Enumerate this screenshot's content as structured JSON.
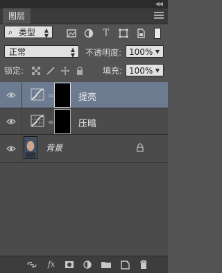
{
  "panel": {
    "tab_label": "图层"
  },
  "filter": {
    "kind_label": "类型",
    "icons": [
      "pixel-filter-icon",
      "adjustment-filter-icon",
      "type-filter-icon",
      "shape-filter-icon",
      "smart-object-filter-icon"
    ]
  },
  "blend": {
    "mode": "正常",
    "opacity_label": "不透明度:",
    "opacity_value": "100%"
  },
  "lock": {
    "label": "锁定:",
    "fill_label": "填充:",
    "fill_value": "100%"
  },
  "layers": [
    {
      "name": "提亮",
      "type": "curves-adjustment",
      "visible": true,
      "selected": true
    },
    {
      "name": "压暗",
      "type": "curves-adjustment",
      "visible": true,
      "selected": false
    },
    {
      "name": "背景",
      "type": "background",
      "visible": true,
      "selected": false,
      "locked": true
    }
  ],
  "bottom_toolbar": [
    "link-layers-icon",
    "fx-icon",
    "add-mask-icon",
    "new-adjustment-icon",
    "new-group-icon",
    "new-layer-icon",
    "delete-icon"
  ],
  "colors": {
    "selected_row": "#6d7b91",
    "panel_bg": "#535353"
  }
}
